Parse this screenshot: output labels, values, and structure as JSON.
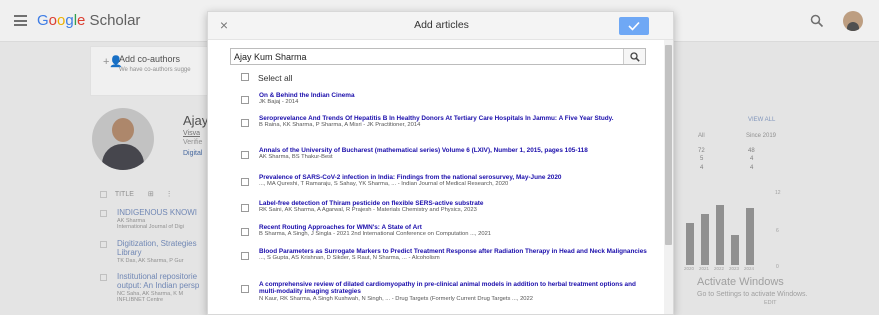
{
  "app": {
    "brand": "Google Scholar",
    "brand_letters": [
      "G",
      "o",
      "o",
      "g",
      "l",
      "e"
    ],
    "brand_suffix": " Scholar"
  },
  "background": {
    "coauthors_title": "Add co-authors",
    "coauthors_sub": "We have co-authors sugge",
    "profile_name": "Ajay",
    "profile_line1": "Visva",
    "profile_line2": "Verifie",
    "profile_line3": "Digital",
    "column_title": "TITLE",
    "articles": [
      {
        "title": "INDIGENOUS KNOWI",
        "meta1": "AK Sharma",
        "meta2": "International Journal of Digi"
      },
      {
        "title": "Digitization, Strategies",
        "title2": "Library",
        "meta1": "TK Das, AK Sharma, P Gur"
      },
      {
        "title": "Institutional repositorie",
        "title2": "output: An Indian persp",
        "meta1": "NC Saha, AK Sharma, K M",
        "meta2": "INFLIBNET Centre"
      }
    ],
    "cited_by": {
      "view_all": "VIEW ALL",
      "col_all": "All",
      "col_since": "Since 2019",
      "rows": [
        [
          "72",
          "48"
        ],
        [
          "5",
          "4"
        ],
        [
          "4",
          "4"
        ]
      ]
    },
    "chart": {
      "ymax_label": "12",
      "ymid_label": "6",
      "ymin_label": "0",
      "years": [
        "2020",
        "2021",
        "2022",
        "2023",
        "2024"
      ],
      "values": [
        7,
        8.5,
        10,
        5,
        9.5
      ]
    },
    "activate_title": "Activate Windows",
    "activate_sub": "Go to Settings to activate Windows.",
    "edit_label": "EDIT"
  },
  "dialog": {
    "title": "Add articles",
    "close_icon": "close-icon",
    "done_icon": "checkmark-icon",
    "accent_color": "#6fa8f5",
    "search_value": "Ajay Kum Sharma",
    "search_icon": "search-icon",
    "select_all_label": "Select all",
    "articles": [
      {
        "title": "On & Behind the Indian Cinema",
        "meta": "JK Bajaj - 2014"
      },
      {
        "title": "Seroprevelance And Trends Of Hepatitis B In Healthy Donors At Tertiary Care Hospitals In Jammu: A Five Year Study.",
        "meta": "B Raina, KK Sharma, P Sharma, A Misri - JK Practitioner, 2014"
      },
      {
        "title": "Annals of the University of Bucharest (mathematical series) Volume 6 (LXIV), Number 1, 2015, pages 105-118",
        "meta": "AK Sharma, BS Thakur-Best"
      },
      {
        "title": "Prevalence of SARS-CoV-2 infection in India: Findings from the national serosurvey, May-June 2020",
        "meta": "..., MA Qureshi, T Ramaraju, S Sahay, YK Sharma, ... - Indian Journal of Medical Research, 2020"
      },
      {
        "title": "Label-free detection of Thiram pesticide on flexible SERS-active substrate",
        "meta": "RK Saini, AK Sharma, A Agarwal, R Prajesh - Materials Chemistry and Physics, 2023"
      },
      {
        "title": "Recent Routing Approaches for WMN's: A State of Art",
        "meta": "B Sharma, A Singh, J Singla - 2021 2nd International Conference on Computation ..., 2021"
      },
      {
        "title": "Blood Parameters as Surrogate Markers to Predict Treatment Response after Radiation Therapy in Head and Neck Malignancies",
        "meta": "..., S Gupta, AS Krishnan, D Sikder, S Raut, N Sharma, ... - Alcoholism"
      },
      {
        "title": "A comprehensive review of dilated cardiomyopathy in pre-clinical animal models in addition to herbal treatment options and multi-modality imaging strategies",
        "meta": "N Kaur, RK Sharma, A Singh Kushwah, N Singh, ... - Drug Targets (Formerly Current Drug Targets ..., 2022"
      }
    ]
  }
}
